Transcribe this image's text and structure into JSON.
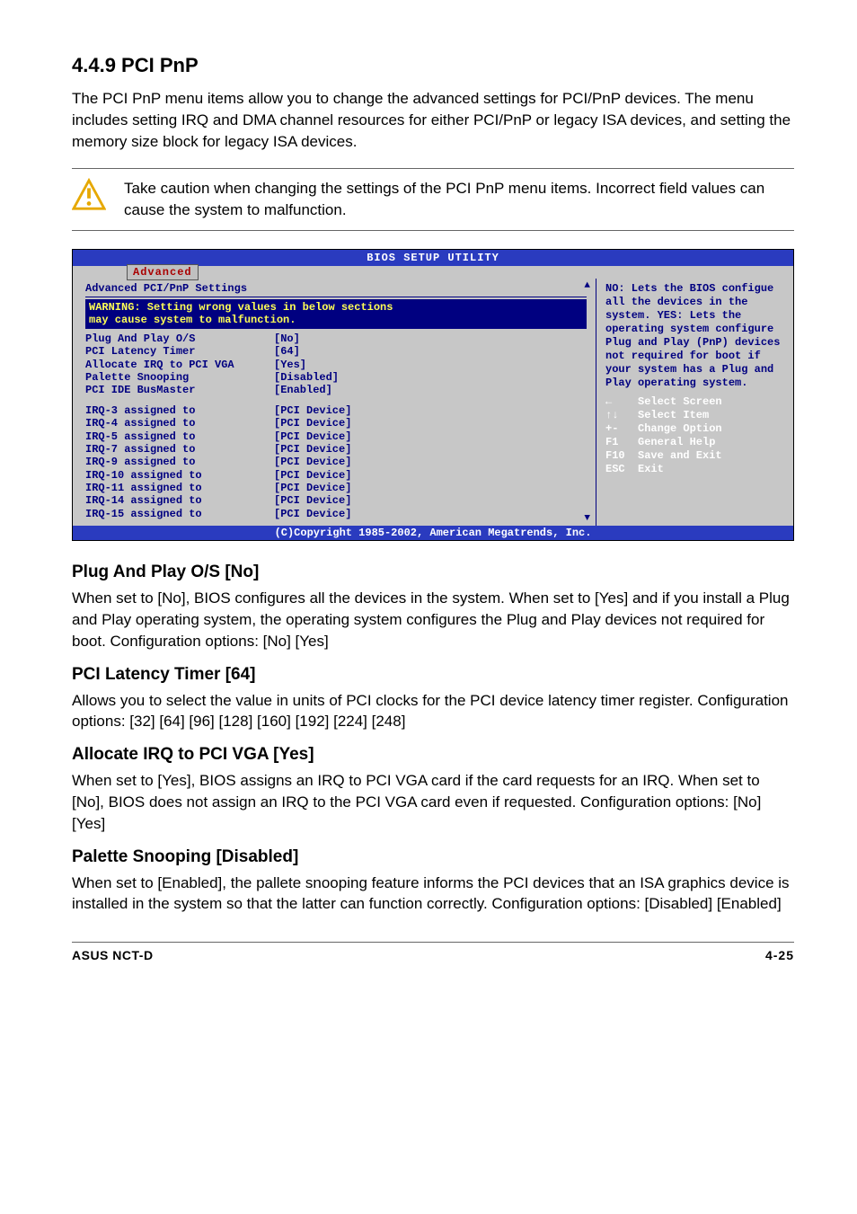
{
  "head": {
    "title": "4.4.9   PCI PnP",
    "intro": "The PCI PnP menu items allow you to change the advanced settings for PCI/PnP devices. The menu includes setting IRQ and DMA channel resources for either PCI/PnP or legacy ISA devices, and setting the memory size block for legacy ISA devices.",
    "note": "Take caution when changing the settings of the PCI PnP menu items. Incorrect field values can cause the system to malfunction."
  },
  "bios": {
    "title": "BIOS SETUP UTILITY",
    "tab": "Advanced",
    "header": "Advanced PCI/PnP Settings",
    "warning1": "WARNING: Setting wrong values in below sections",
    "warning2": "         may cause system to malfunction.",
    "settings": [
      {
        "label": "Plug And Play O/S",
        "value": "[No]"
      },
      {
        "label": "PCI Latency Timer",
        "value": "[64]"
      },
      {
        "label": "Allocate IRQ to PCI VGA",
        "value": "[Yes]"
      },
      {
        "label": "Palette Snooping",
        "value": "[Disabled]"
      },
      {
        "label": "PCI IDE BusMaster",
        "value": "[Enabled]"
      }
    ],
    "irqs": [
      {
        "label": "IRQ-3 assigned to",
        "value": "[PCI Device]"
      },
      {
        "label": "IRQ-4 assigned to",
        "value": "[PCI Device]"
      },
      {
        "label": "IRQ-5 assigned to",
        "value": "[PCI Device]"
      },
      {
        "label": "IRQ-7 assigned to",
        "value": "[PCI Device]"
      },
      {
        "label": "IRQ-9 assigned to",
        "value": "[PCI Device]"
      },
      {
        "label": "IRQ-10 assigned to",
        "value": "[PCI Device]"
      },
      {
        "label": "IRQ-11 assigned to",
        "value": "[PCI Device]"
      },
      {
        "label": "IRQ-14 assigned to",
        "value": "[PCI Device]"
      },
      {
        "label": "IRQ-15 assigned to",
        "value": "[PCI Device]"
      }
    ],
    "help": "NO: Lets the BIOS configue all the devices in the system. YES: Lets the operating system configure Plug and Play (PnP) devices not required for boot if your system has a Plug and Play operating system.",
    "keys": [
      {
        "k": "←",
        "d": "Select Screen"
      },
      {
        "k": "↑↓",
        "d": "Select Item"
      },
      {
        "k": "+-",
        "d": "Change Option"
      },
      {
        "k": "F1",
        "d": "General Help"
      },
      {
        "k": "F10",
        "d": "Save and Exit"
      },
      {
        "k": "ESC",
        "d": "Exit"
      }
    ],
    "footer": "(C)Copyright 1985-2002, American Megatrends, Inc."
  },
  "sections": {
    "s1h": "Plug And Play O/S [No]",
    "s1b": "When set to [No], BIOS configures all the devices in the system. When set to [Yes] and if you install a Plug and Play operating system, the operating system configures the Plug and Play devices not required for boot. Configuration options: [No] [Yes]",
    "s2h": "PCI Latency Timer [64]",
    "s2b": "Allows you to select the value in units of PCI clocks for the PCI device latency timer register. Configuration options: [32] [64] [96] [128] [160] [192] [224] [248]",
    "s3h": "Allocate IRQ to PCI VGA [Yes]",
    "s3b": "When set to [Yes], BIOS assigns an IRQ to PCI VGA card if the card requests for an IRQ. When set to [No], BIOS does not assign an IRQ to the PCI VGA card even if requested. Configuration options: [No] [Yes]",
    "s4h": "Palette Snooping [Disabled]",
    "s4b": "When set to [Enabled], the pallete snooping feature informs the PCI devices that an ISA graphics device is installed in the system so that the latter can function correctly. Configuration options: [Disabled] [Enabled]"
  },
  "footer": {
    "left": "ASUS NCT-D",
    "right": "4-25"
  }
}
